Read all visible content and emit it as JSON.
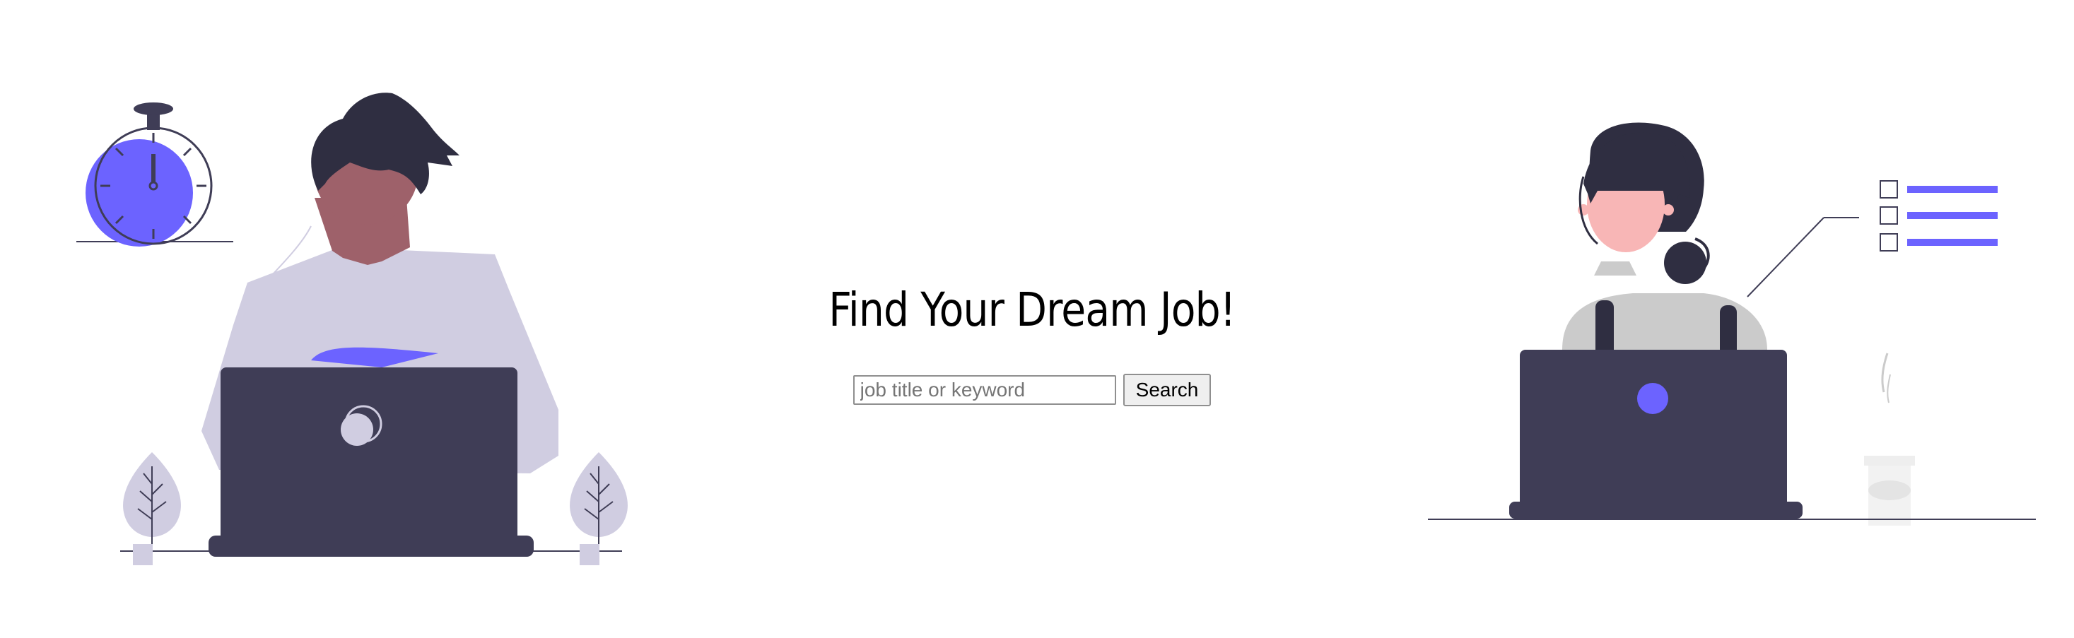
{
  "hero": {
    "title": "Find Your Dream Job!"
  },
  "search": {
    "placeholder": "job title or keyword",
    "value": "",
    "button_label": "Search"
  },
  "illustrations": {
    "left": "man-at-laptop-with-stopwatch-illustration",
    "right": "woman-at-laptop-with-checklist-illustration"
  },
  "colors": {
    "accent": "#6c63ff",
    "dark": "#3f3d56",
    "hair": "#2f2e41",
    "lavender": "#d0cde1",
    "skin_left": "#9e616a",
    "skin_right": "#f8b6b6"
  }
}
